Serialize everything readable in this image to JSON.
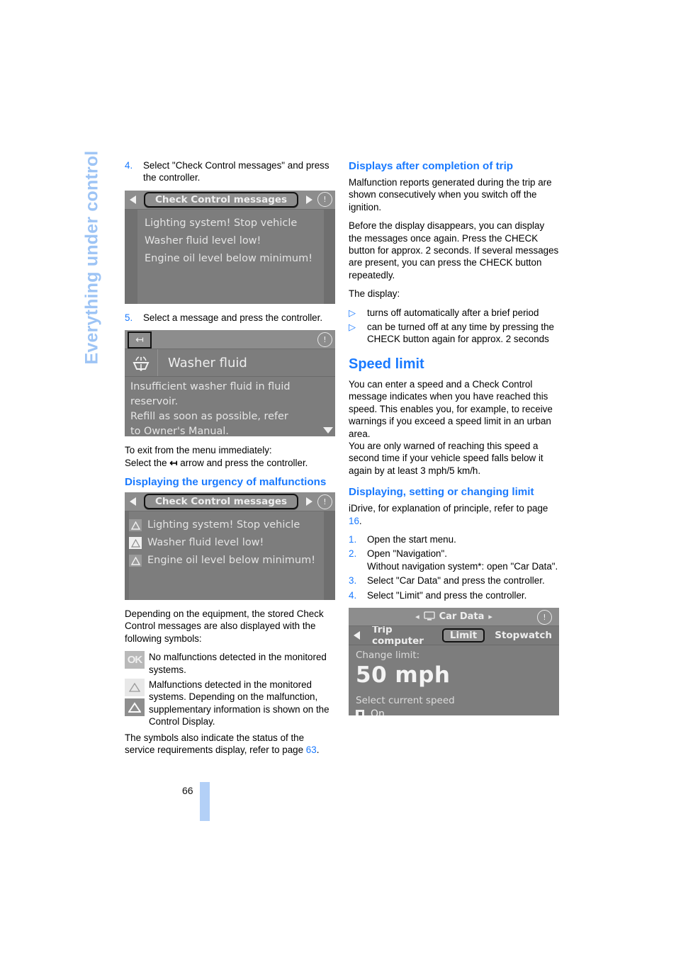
{
  "chapter_tab": "Everything under control",
  "page_number": "66",
  "left_column": {
    "step4": {
      "num": "4.",
      "text": "Select \"Check Control messages\" and press the controller."
    },
    "display1": {
      "title": "Check Control messages",
      "messages": [
        "Lighting system! Stop vehicle",
        "Washer fluid level low!",
        "Engine oil level below minimum!"
      ]
    },
    "step5": {
      "num": "5.",
      "text": "Select a message and press the controller."
    },
    "display2": {
      "back_icon": "back-arrow-icon",
      "item_icon": "washer-fluid-icon",
      "item_title": "Washer fluid",
      "body_lines": [
        "Insufficient washer fluid in fluid",
        "reservoir.",
        "Refill as soon as possible, refer",
        "to Owner's Manual."
      ]
    },
    "exit_note_line1": "To exit from the menu immediately:",
    "exit_note_line2_before": "Select the",
    "exit_note_line2_after": "arrow and press the controller.",
    "heading_urgency": "Displaying the urgency of malfunctions",
    "display3": {
      "title": "Check Control messages",
      "rows": [
        {
          "icon": "warning-triangle-dark-icon",
          "text": "Lighting system! Stop vehicle"
        },
        {
          "icon": "warning-triangle-light-icon",
          "text": "Washer fluid level low!"
        },
        {
          "icon": "warning-triangle-dark-icon",
          "text": "Engine oil level below minimum!"
        }
      ]
    },
    "symbols_intro": "Depending on the equipment, the stored Check Control messages are also displayed with the following symbols:",
    "legend": [
      {
        "symbols": [
          "ok-symbol"
        ],
        "ok_label": "OK",
        "text": "No malfunctions detected in the monitored systems."
      },
      {
        "symbols": [
          "triangle-light-symbol",
          "triangle-dark-symbol"
        ],
        "text": "Malfunctions detected in the monitored systems. Depending on the malfunction, supplementary information is shown on the Control Display."
      }
    ],
    "service_note_before": "The symbols also indicate the status of the service requirements display, refer to page",
    "service_note_page": "63",
    "service_note_after": "."
  },
  "right_column": {
    "heading_displays": "Displays after completion of trip",
    "para1": "Malfunction reports generated during the trip are shown consecutively when you switch off the ignition.",
    "para2": "Before the display disappears, you can display the messages once again. Press the CHECK button for approx. 2 seconds. If several messages are present, you can press the CHECK button repeatedly.",
    "para3": "The display:",
    "bullets": [
      "turns off automatically after a brief period",
      "can be turned off at any time by pressing the CHECK button again for approx. 2 seconds"
    ],
    "heading_speed_limit": "Speed limit",
    "para4": "You can enter a speed and a Check Control message indicates when you have reached this speed. This enables you, for example, to receive warnings if you exceed a speed limit in an urban area.",
    "para5": "You are only warned of reaching this speed a second time if your vehicle speed falls below it again by at least 3 mph/5 km/h.",
    "heading_changing_limit": "Displaying, setting or changing limit",
    "idrive_note_before": "iDrive, for explanation of principle, refer to page",
    "idrive_note_page": "16",
    "idrive_note_after": ".",
    "steps": [
      {
        "num": "1.",
        "text": "Open the start menu."
      },
      {
        "num": "2.",
        "text": "Open \"Navigation\".",
        "sub": "Without navigation system*: open \"Car Data\"."
      },
      {
        "num": "3.",
        "text": "Select \"Car Data\" and press the controller."
      },
      {
        "num": "4.",
        "text": "Select \"Limit\" and press the controller."
      }
    ],
    "display4": {
      "title": "Car Data",
      "tabs": [
        "Trip computer",
        "Limit",
        "Stopwatch"
      ],
      "selected_tab": "Limit",
      "change_label": "Change limit:",
      "value": "50 mph",
      "select_label": "Select current speed",
      "checkbox_label": "On"
    }
  },
  "colors": {
    "heading_blue": "#1a7aff",
    "tab_blue": "#9dc4f5",
    "page_bar_blue": "#b3d0f7",
    "display_gray": "#7d7d7d"
  }
}
